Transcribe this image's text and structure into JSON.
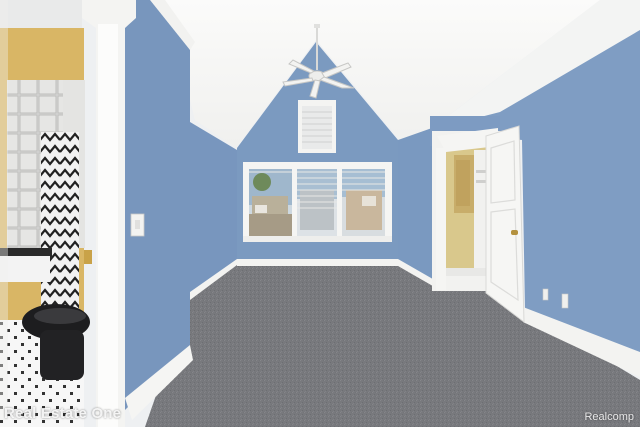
{
  "watermarks": {
    "left": "Real Estate One",
    "right": "Realcomp"
  },
  "icons": [
    "ceiling-fan-icon",
    "light-switch-icon",
    "outlet-icon",
    "door-hinge-icon",
    "door-knob-icon"
  ],
  "colors": {
    "wall": "#7e9cc0",
    "wall_shadow": "#6d8bb2",
    "ceiling": "#f6f6f4",
    "carpet": "#77797c",
    "trim": "#f4f4f2",
    "bath_wall": "#d9b665"
  }
}
